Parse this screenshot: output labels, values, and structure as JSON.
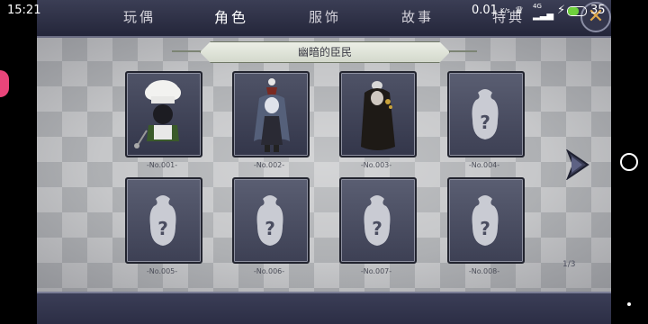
{
  "status_bar": {
    "time": "15:21",
    "speed": "0.01",
    "speed_unit": "K/s",
    "network": "4G",
    "battery": "35"
  },
  "tabs": [
    {
      "label": "玩偶",
      "active": false
    },
    {
      "label": "角色",
      "active": true
    },
    {
      "label": "服饰",
      "active": false
    },
    {
      "label": "故事",
      "active": false
    },
    {
      "label": "特典",
      "active": false
    }
  ],
  "banner": {
    "title": "幽暗的臣民"
  },
  "cards": [
    {
      "no": "-No.001-",
      "state": "unlocked",
      "character": "chef"
    },
    {
      "no": "-No.002-",
      "state": "unlocked",
      "character": "long-hair-girl"
    },
    {
      "no": "-No.003-",
      "state": "unlocked",
      "character": "dark-robe"
    },
    {
      "no": "-No.004-",
      "state": "locked"
    },
    {
      "no": "-No.005-",
      "state": "locked"
    },
    {
      "no": "-No.006-",
      "state": "locked"
    },
    {
      "no": "-No.007-",
      "state": "locked"
    },
    {
      "no": "-No.008-",
      "state": "locked"
    }
  ],
  "pager": "1/3",
  "icons": {
    "close": "close-icon",
    "next": "next-page-arrow-icon",
    "locked": "locked-question-icon"
  },
  "colors": {
    "accent_gold": "#e0a84a",
    "topbar": "#2b2d44",
    "card": "#3d4054",
    "banner": "#dfe3d8"
  }
}
